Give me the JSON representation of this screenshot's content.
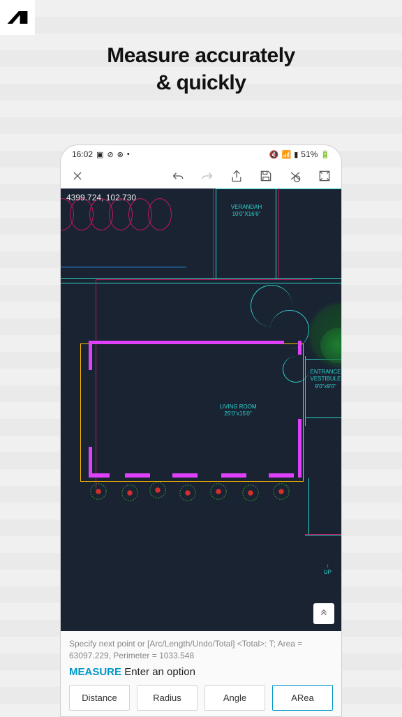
{
  "headline": {
    "line1": "Measure accurately",
    "line2": "& quickly"
  },
  "statusbar": {
    "time": "16:02",
    "battery": "51%"
  },
  "canvas": {
    "coords": "4399.724, 102.730",
    "rooms": {
      "verandah": {
        "name": "VERANDAH",
        "dim": "10'0\"X16'6\""
      },
      "living": {
        "name": "LIVING ROOM",
        "dim": "25'0\"x15'0\""
      },
      "entrance": {
        "name": "ENTRANCE",
        "sub": "VESTIBULE",
        "dim": "9'0\"x9'0\""
      }
    },
    "up_label": "UP"
  },
  "command": {
    "hint": "Specify next point or [Arc/Length/Undo/Total] <Total>: T; Area = 63097.229, Perimeter = 1033.548",
    "name": "MEASURE",
    "prompt": "Enter an option"
  },
  "options": {
    "distance": "Distance",
    "radius": "Radius",
    "angle": "Angle",
    "area": "ARea"
  }
}
